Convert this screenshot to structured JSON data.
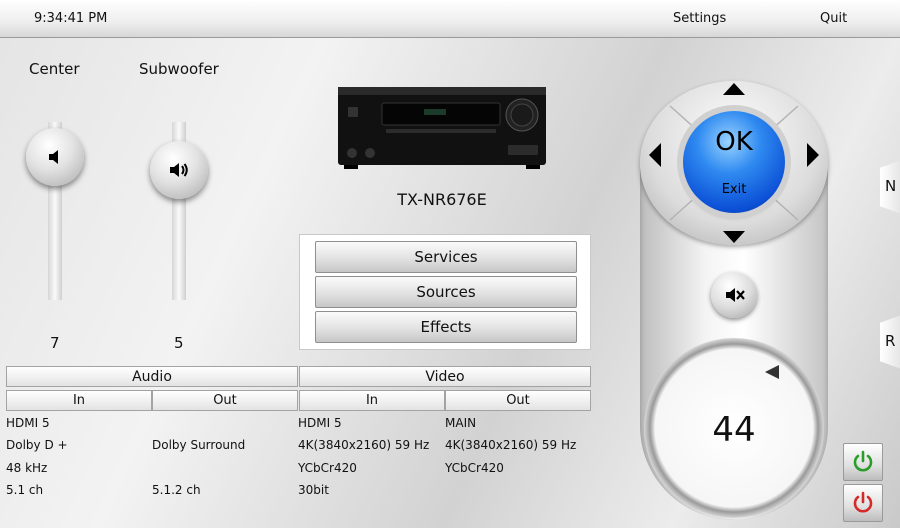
{
  "topbar": {
    "clock": "9:34:41 PM",
    "settings_label": "Settings",
    "quit_label": "Quit"
  },
  "channels": {
    "center": {
      "label": "Center",
      "value": "7",
      "icon": "speaker-low-icon"
    },
    "subwoofer": {
      "label": "Subwoofer",
      "value": "5",
      "icon": "speaker-mid-icon"
    }
  },
  "device": {
    "model": "TX-NR676E"
  },
  "menu": {
    "services": "Services",
    "sources": "Sources",
    "effects": "Effects"
  },
  "info": {
    "audio_header": "Audio",
    "video_header": "Video",
    "in_label": "In",
    "out_label": "Out",
    "audio_in": [
      "HDMI 5",
      "Dolby D +",
      "48 kHz",
      "5.1 ch"
    ],
    "audio_out": [
      "",
      "Dolby Surround",
      "",
      "5.1.2 ch"
    ],
    "video_in": [
      "HDMI 5",
      "4K(3840x2160) 59 Hz",
      "YCbCr420",
      "30bit"
    ],
    "video_out": [
      "MAIN",
      "4K(3840x2160) 59 Hz",
      "YCbCr420",
      ""
    ]
  },
  "remote": {
    "ok_label": "OK",
    "exit_label": "Exit",
    "volume": "44"
  },
  "side_tabs": {
    "top": "N",
    "bottom": "R"
  },
  "colors": {
    "ok_blue": "#2f8af0",
    "power_on": "#2a9d2a",
    "power_off": "#d42a2a"
  }
}
